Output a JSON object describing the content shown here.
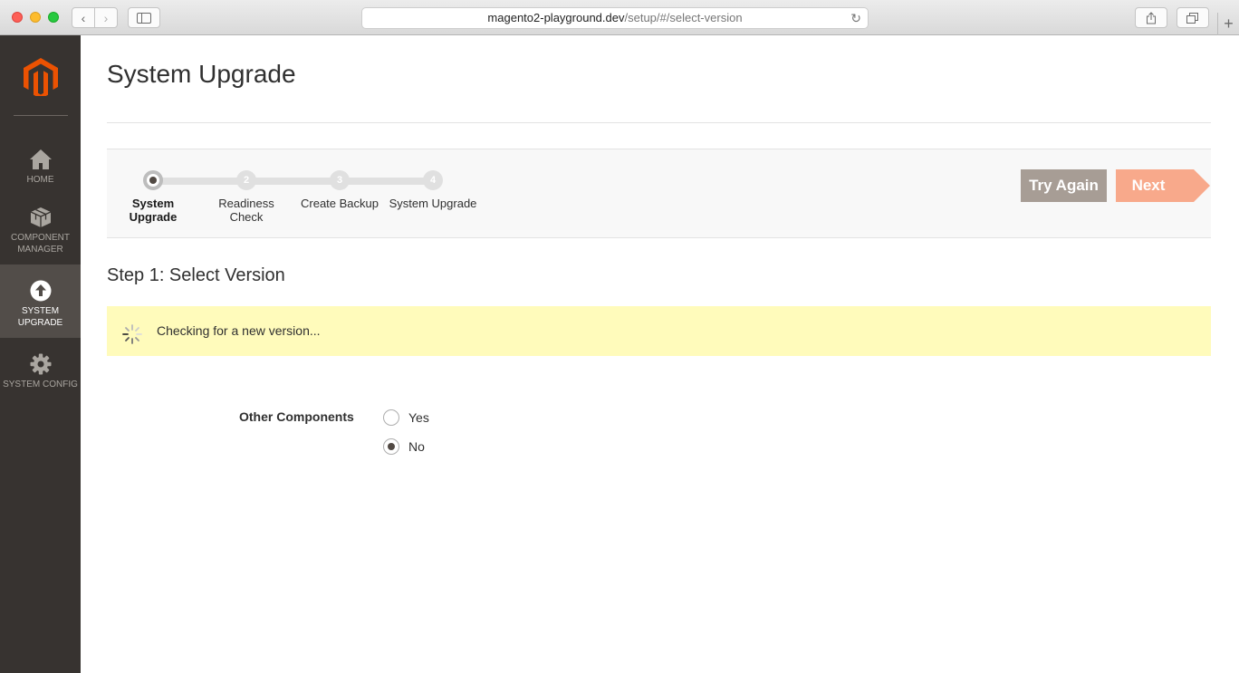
{
  "browser": {
    "url_host": "magento2-playground.dev",
    "url_path": "/setup/#/select-version",
    "icons": [
      "back-icon",
      "forward-icon",
      "sidebar-icon",
      "reload-icon",
      "share-icon",
      "tabs-icon",
      "plus-icon"
    ]
  },
  "sidebar": {
    "items": [
      {
        "label": "HOME",
        "icon": "home-icon",
        "active": false
      },
      {
        "label": "COMPONENT MANAGER",
        "icon": "cubes-icon",
        "active": false
      },
      {
        "label": "SYSTEM UPGRADE",
        "icon": "upload-arrow-icon",
        "active": true
      },
      {
        "label": "SYSTEM CONFIG",
        "icon": "gear-icon",
        "active": false
      }
    ]
  },
  "page": {
    "title": "System Upgrade"
  },
  "progress": {
    "steps": [
      {
        "number": "1",
        "label": "System Upgrade",
        "current": true
      },
      {
        "number": "2",
        "label": "Readiness Check",
        "current": false
      },
      {
        "number": "3",
        "label": "Create Backup",
        "current": false
      },
      {
        "number": "4",
        "label": "System Upgrade",
        "current": false
      }
    ],
    "try_again_label": "Try Again",
    "next_label": "Next"
  },
  "step": {
    "heading": "Step 1: Select Version",
    "notice_text": "Checking for a new version...",
    "other_components_label": "Other Components",
    "options": [
      {
        "label": "Yes",
        "checked": false
      },
      {
        "label": "No",
        "checked": true
      }
    ]
  },
  "colors": {
    "sidebar_bg": "#373330",
    "sidebar_active": "#524d49",
    "brand_orange": "#eb5202",
    "next_button": "#f8a98b",
    "try_again_button": "#a79d95",
    "notice_bg": "#fffbbb"
  }
}
